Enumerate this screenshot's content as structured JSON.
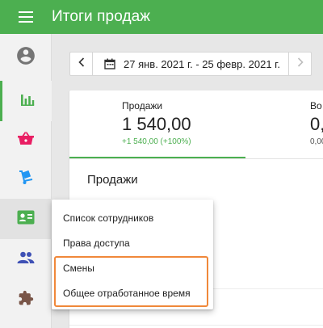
{
  "header": {
    "title": "Итоги продаж",
    "menu_icon": "hamburger-menu-icon",
    "background": "#4caf50"
  },
  "sidebar": {
    "items": [
      {
        "name": "profile",
        "icon": "account-circle-icon",
        "color": "#757575"
      },
      {
        "name": "reports",
        "icon": "bar-chart-icon",
        "color": "#4caf50",
        "active": true
      },
      {
        "name": "goods",
        "icon": "basket-icon",
        "color": "#e91e63"
      },
      {
        "name": "inventory",
        "icon": "dolly-icon",
        "color": "#2196f3"
      },
      {
        "name": "employees",
        "icon": "badge-icon",
        "color": "#4caf50",
        "hovered": true
      },
      {
        "name": "customers",
        "icon": "people-icon",
        "color": "#3f51b5"
      },
      {
        "name": "addons",
        "icon": "puzzle-icon",
        "color": "#795548"
      }
    ]
  },
  "date_filter": {
    "range": "27 янв. 2021 г. - 25 февр. 2021 г.",
    "icons": [
      "chevron-left-icon",
      "calendar-icon",
      "chevron-right-icon"
    ]
  },
  "summary": {
    "kpis": [
      {
        "label": "Продажи",
        "value": "1 540,00",
        "delta": "+1 540,00 (+100%)"
      },
      {
        "label": "Во",
        "value": "0,",
        "delta": "0,00"
      }
    ],
    "section_title": "Продажи"
  },
  "employees_menu": {
    "items": [
      "Список сотрудников",
      "Права доступа",
      "Смены",
      "Общее отработанное время"
    ],
    "highlight_color": "#f0883a"
  }
}
